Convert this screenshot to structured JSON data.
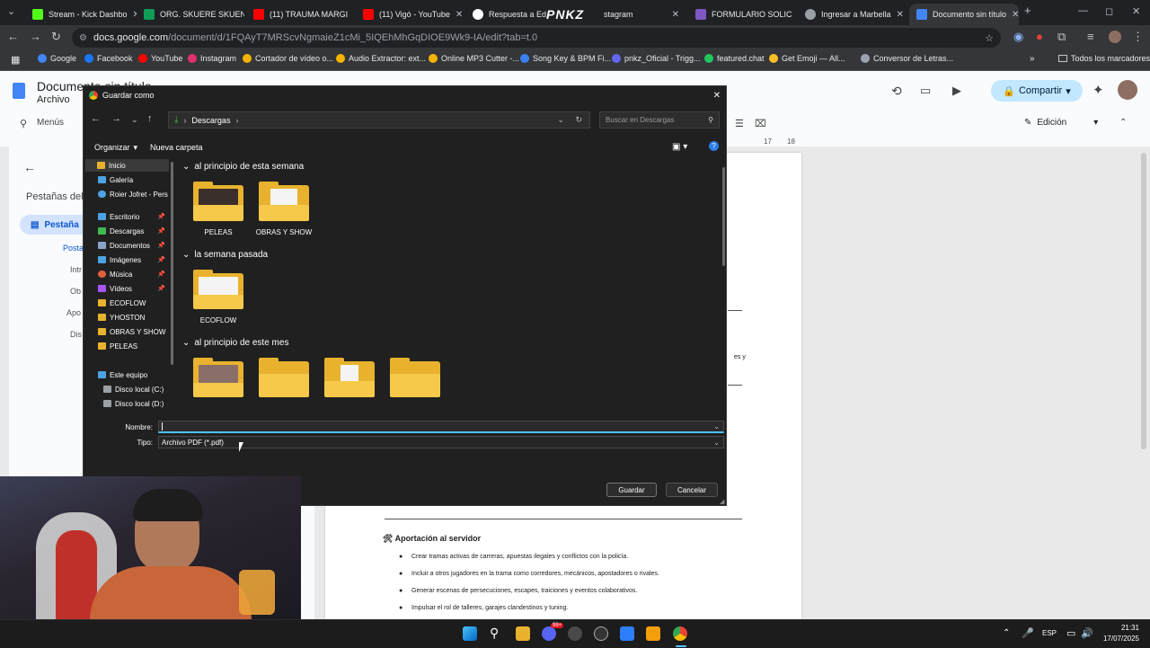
{
  "browser": {
    "tabs": [
      {
        "label": "Stream - Kick Dashbo",
        "color": "#53fc18"
      },
      {
        "label": "ORG. SKUERE SKUEN",
        "color": "#0f9d58"
      },
      {
        "label": "(11) TRAUMA MARGI",
        "color": "#ff0000"
      },
      {
        "label": "(11) Vigó - YouTube",
        "color": "#ff0000"
      },
      {
        "label": "Respuesta a Edv",
        "color": "#ffffff"
      },
      {
        "label": "stagram",
        "color": "#e1306c"
      },
      {
        "label": "FORMULARIO SOLIC",
        "color": "#7e57c2"
      },
      {
        "label": "Ingresar a Marbella",
        "color": "#9aa0a6"
      },
      {
        "label": "Documento sin título",
        "color": "#4285f4"
      }
    ],
    "overlay_logo": "PNKZ",
    "new_tab": "+",
    "url_host": "docs.google.com",
    "url_path": "/document/d/1FQAyT7MRScvNgmaieZ1cMi_5IQEhMhGqDIOE9Wk9-IA/edit?tab=t.0",
    "bookmarks": [
      {
        "label": "Google",
        "color": "#4285f4"
      },
      {
        "label": "Facebook",
        "color": "#1877f2"
      },
      {
        "label": "YouTube",
        "color": "#ff0000"
      },
      {
        "label": "Instagram",
        "color": "#e1306c"
      },
      {
        "label": "Cortador de vídeo o...",
        "color": "#f4b400"
      },
      {
        "label": "Audio Extractor: ext...",
        "color": "#f4b400"
      },
      {
        "label": "Online MP3 Cutter -...",
        "color": "#f4b400"
      },
      {
        "label": "Song Key & BPM Fi...",
        "color": "#3b82f6"
      },
      {
        "label": "pnkz_Oficial - Trigg...",
        "color": "#6366f1"
      },
      {
        "label": "featured.chat",
        "color": "#22c55e"
      },
      {
        "label": "Get Emoji — All...",
        "color": "#fbbf24"
      },
      {
        "label": "Conversor de Letras...",
        "color": "#9ca3af"
      }
    ],
    "all_bookmarks": "Todos los marcadores"
  },
  "docs": {
    "title": "Documento sin título",
    "menu_file": "Archivo",
    "menus_label": "Menús",
    "share_label": "Compartir",
    "edit_mode": "Edición",
    "tabs_panel_title": "Pestañas del",
    "tab_name": "Pestaña",
    "outline": [
      "Posta",
      "Intr",
      "Ob",
      "Apo",
      "Dis"
    ],
    "ruler_marks": [
      "17",
      "18"
    ],
    "section_heading": "🛠 Aportación al servidor",
    "bullets": [
      "Crear tramas activas de carreras, apuestas ilegales y conflictos con la policía.",
      "Incluir a otros jugadores en la trama como corredores, mecánicos, apostadores o rivales.",
      "Generar escenas de persecuciones, escapes, traiciones y eventos colaborativos.",
      "Impulsar el rol de talleres, garajes clandestinos y tuning."
    ],
    "side_fragment": "es y"
  },
  "dialog": {
    "title": "Guardar como",
    "breadcrumb": "Descargas",
    "search_placeholder": "Buscar en Descargas",
    "organize": "Organizar",
    "new_folder": "Nueva carpeta",
    "nav": [
      {
        "label": "Inicio",
        "selected": true,
        "color": "#e8b22e"
      },
      {
        "label": "Galería",
        "color": "#4ba3e3"
      },
      {
        "label": "Roier Jofret - Pers",
        "color": "#4ba3e3"
      },
      {
        "label": "Escritorio",
        "pinned": true,
        "color": "#4ba3e3"
      },
      {
        "label": "Descargas",
        "pinned": true,
        "color": "#3fb950"
      },
      {
        "label": "Documentos",
        "pinned": true,
        "color": "#8aa4c8"
      },
      {
        "label": "Imágenes",
        "pinned": true,
        "color": "#4ba3e3"
      },
      {
        "label": "Música",
        "pinned": true,
        "color": "#e0603a"
      },
      {
        "label": "Vídeos",
        "pinned": true,
        "color": "#a855f7"
      },
      {
        "label": "ECOFLOW",
        "color": "#e8b22e"
      },
      {
        "label": "YHOSTON",
        "color": "#e8b22e"
      },
      {
        "label": "OBRAS Y SHOW",
        "color": "#e8b22e"
      },
      {
        "label": "PELEAS",
        "color": "#e8b22e"
      },
      {
        "label": "Este equipo",
        "color": "#4ba3e3"
      },
      {
        "label": "Disco local (C:)",
        "color": "#9aa0a6"
      },
      {
        "label": "Disco local (D:)",
        "color": "#9aa0a6"
      }
    ],
    "groups": [
      {
        "title": "al principio de esta semana",
        "folders": [
          "PELEAS",
          "OBRAS Y SHOW"
        ]
      },
      {
        "title": "la semana pasada",
        "folders": [
          "ECOFLOW"
        ]
      },
      {
        "title": "al principio de este mes",
        "folders": [
          "",
          "",
          "",
          ""
        ]
      }
    ],
    "name_label": "Nombre:",
    "name_value": "",
    "type_label": "Tipo:",
    "type_value": "Archivo PDF (*.pdf)",
    "save_button": "Guardar",
    "cancel_button": "Cancelar"
  },
  "taskbar": {
    "lang": "ESP",
    "time": "21:31",
    "date": "17/07/2025",
    "chat_badge": "99+"
  }
}
